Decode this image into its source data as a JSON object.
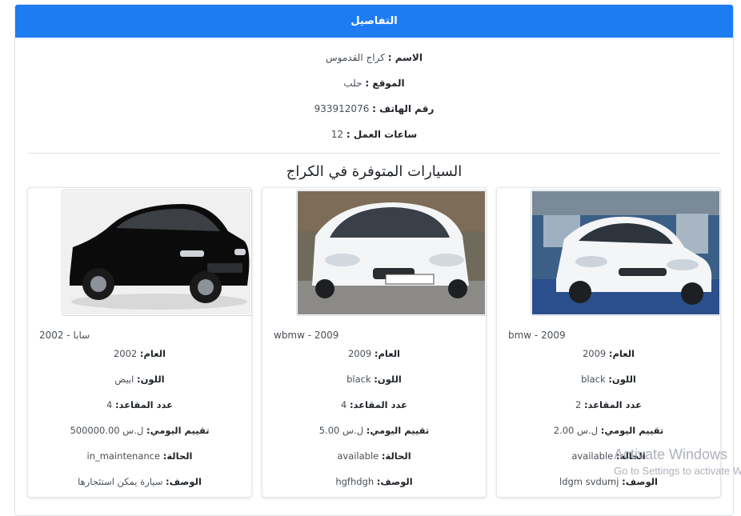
{
  "panel": {
    "title": "التفاصيل"
  },
  "garage": {
    "name_label": "الاسم :",
    "name": "كراج القدموس",
    "location_label": "الموقع :",
    "location": "حلب",
    "phone_label": "رقم الهاتف :",
    "phone": "933912076",
    "hours_label": "ساعات العمل :",
    "hours": "12"
  },
  "cars_section_title": "السيارات المتوفرة في الكراج",
  "cars": [
    {
      "title": "bmw - 2009",
      "body_color": "#f5f6f7",
      "bg": "#3b5f86",
      "year_label": "العام:",
      "year": "2009",
      "color_label": "اللون:",
      "color": "black",
      "seats_label": "عدد المقاعد:",
      "seats": "2",
      "rate_label": "تقييم اليومي:",
      "rate": "ل.س 2.00",
      "status_label": "الحالة:",
      "status": "available",
      "desc_label": "الوصف:",
      "desc": "ldgm svdumj"
    },
    {
      "title": "wbmw - 2009",
      "body_color": "#f4f5f6",
      "bg": "#6f6a5c",
      "year_label": "العام:",
      "year": "2009",
      "color_label": "اللون:",
      "color": "black",
      "seats_label": "عدد المقاعد:",
      "seats": "4",
      "rate_label": "تقييم اليومي:",
      "rate": "ل.س 5.00",
      "status_label": "الحالة:",
      "status": "available",
      "desc_label": "الوصف:",
      "desc": "hgfhdgh"
    },
    {
      "title": "سابا - 2002",
      "body_color": "#0b0b0c",
      "bg": "#f0f0f0",
      "year_label": "العام:",
      "year": "2002",
      "color_label": "اللون:",
      "color": "ابيض",
      "seats_label": "عدد المقاعد:",
      "seats": "4",
      "rate_label": "تقييم اليومي:",
      "rate": "ل.س 500000.00",
      "status_label": "الحالة:",
      "status": "in_maintenance",
      "desc_label": "الوصف:",
      "desc": "سيارة يمكن استئجارها"
    }
  ],
  "watermark": {
    "line1": "Activate Windows",
    "line2": "Go to Settings to activate Windows."
  }
}
